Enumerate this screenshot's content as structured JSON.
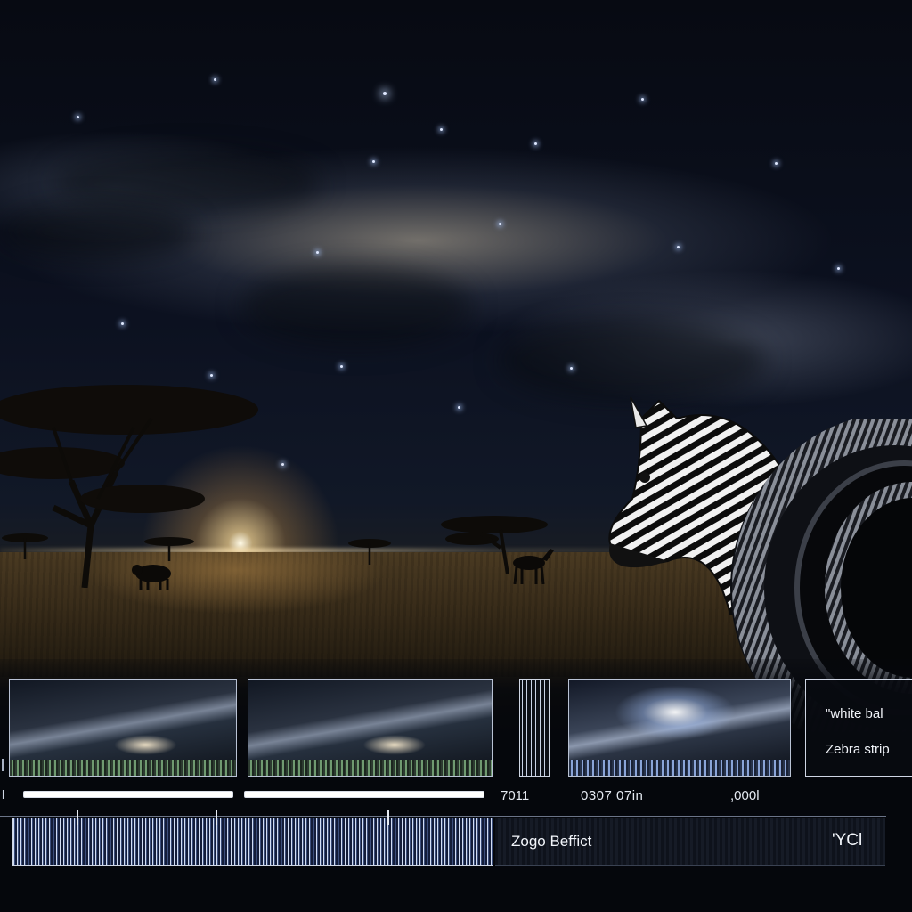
{
  "labels": {
    "white_balance": "\"white bal",
    "zebra_stripes": "Zebra strip",
    "meter_value": "7011",
    "timecode": "0307 07in",
    "value_right": ",000l",
    "left_tick": "l",
    "zogo_effect": "Zogo  Beffict",
    "yci": "'YCl"
  },
  "progress": {
    "bar_1_fraction": 0.0,
    "bar_2_fraction": 0.0
  },
  "colors": {
    "accent_blue": "#8aa4d8",
    "strip_green": "#6f9a70",
    "progress_red": "#ff9aa2",
    "panel_border": "#cfd6e4"
  },
  "icons": {
    "lens": "camera-lens-icon"
  }
}
